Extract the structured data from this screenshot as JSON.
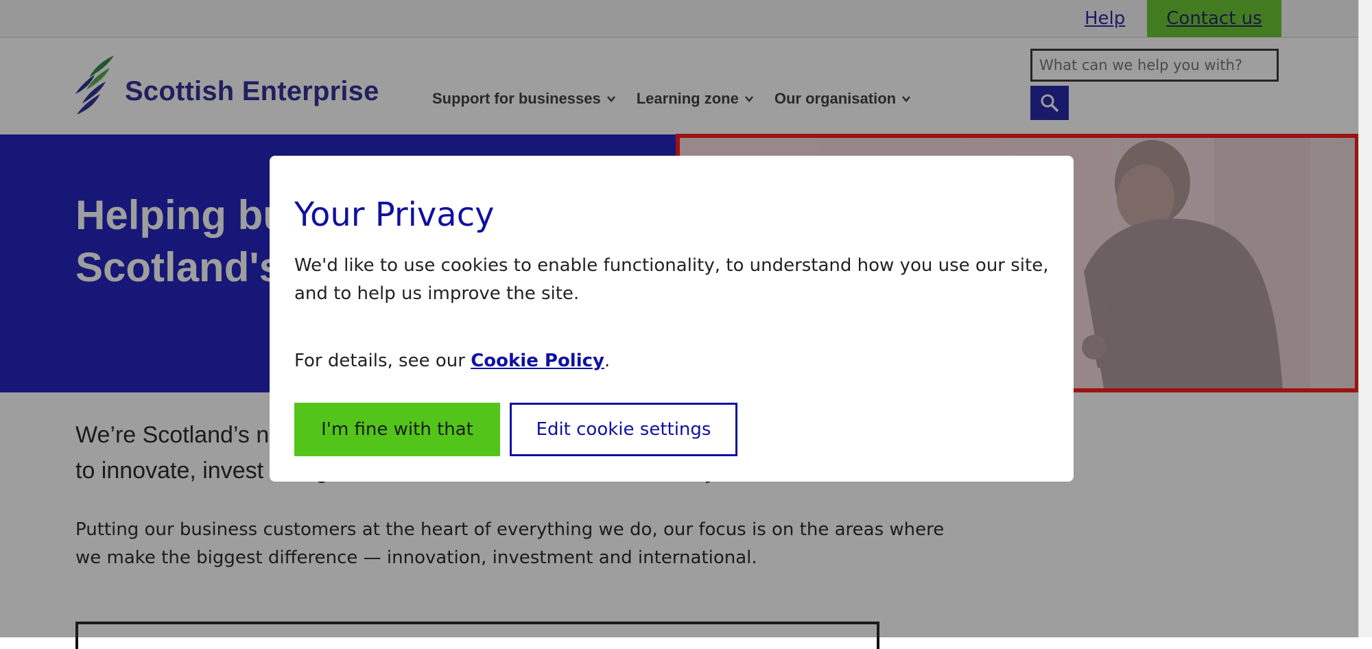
{
  "utility": {
    "help": "Help",
    "contact": "Contact us"
  },
  "header": {
    "logo_text": "Scottish Enterprise",
    "nav": [
      "Support for businesses",
      "Learning zone",
      "Our organisation"
    ],
    "search_placeholder": "What can we help you with?"
  },
  "hero": {
    "title": "Helping businesses transform Scotland's economy"
  },
  "main": {
    "intro": "We’re Scotland’s national economic development agency, and we work with businesses to innovate, invest and grow, to transform Scotland’s economy.",
    "desc": "Putting our business customers at the heart of everything we do, our focus is on the areas where we make the biggest difference — innovation, investment and international."
  },
  "privacy": {
    "title": "Your Privacy",
    "text": "We'd like to use cookies to enable functionality, to understand how you use our site, and to help us improve the site.",
    "details_prefix": "For details, see our ",
    "policy_link": "Cookie Policy",
    "details_suffix": ".",
    "accept": "I'm fine with that",
    "edit": "Edit cookie settings"
  },
  "colors": {
    "brand_blue": "#1010a0",
    "hero_blue": "#0a0ab8",
    "accent_green": "#52c41a",
    "highlight_red": "#ff0000"
  },
  "icons": [
    "logo-mark",
    "chevron-down-icon",
    "search-icon"
  ]
}
